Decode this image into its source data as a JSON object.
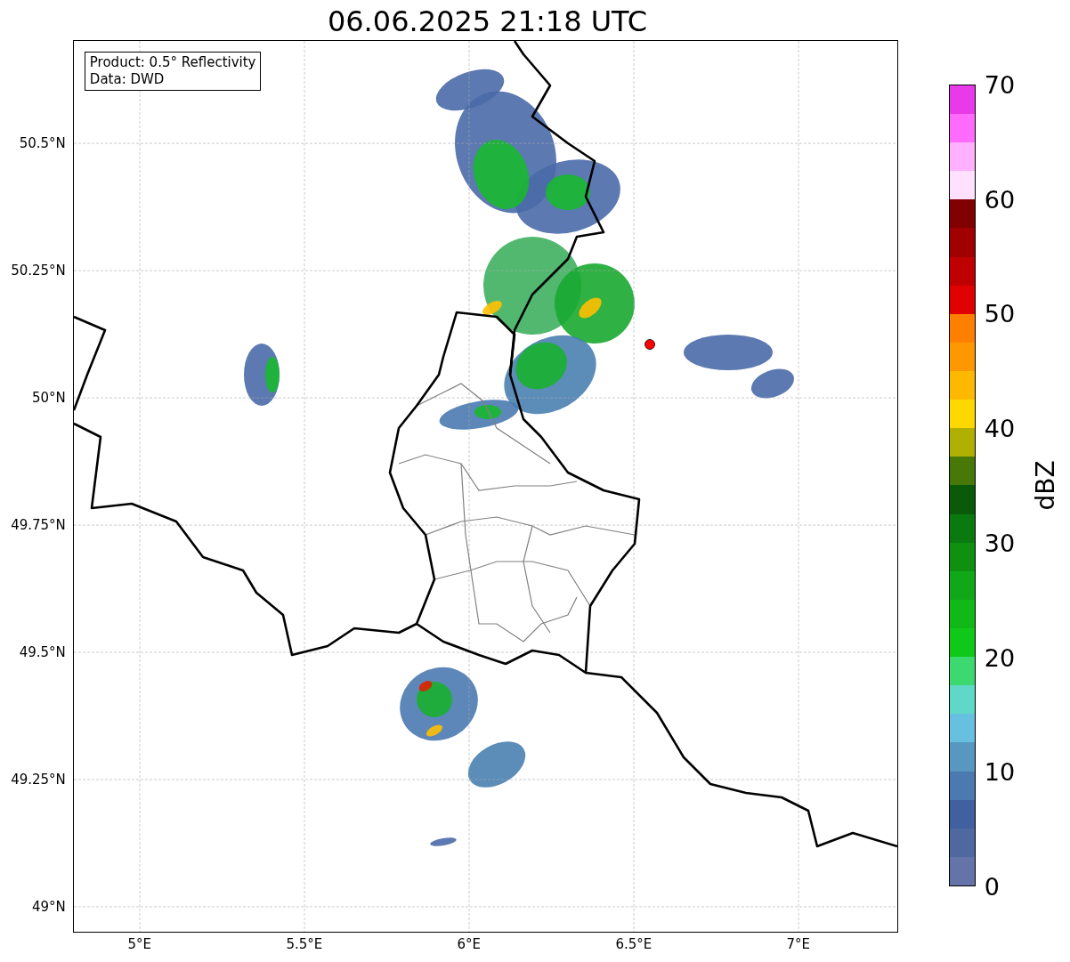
{
  "title": "06.06.2025 21:18 UTC",
  "map": {
    "info_lines": [
      "Product: 0.5° Reflectivity",
      "Data: DWD"
    ],
    "lat_labels": [
      "50.5°N",
      "50.25°N",
      "50°N",
      "49.75°N",
      "49.5°N",
      "49.25°N",
      "49°N"
    ],
    "lon_labels": [
      "5°E",
      "5.5°E",
      "6°E",
      "6.5°E",
      "7°E"
    ]
  },
  "colorbar": {
    "label": "dBZ",
    "ticks": [
      "70",
      "60",
      "50",
      "40",
      "30",
      "20",
      "10",
      "0"
    ],
    "bands": [
      {
        "color": "#6474a8"
      },
      {
        "color": "#5068a0"
      },
      {
        "color": "#4060a0"
      },
      {
        "color": "#4a7ab0"
      },
      {
        "color": "#5898c0"
      },
      {
        "color": "#68c0e0"
      },
      {
        "color": "#60d8c8"
      },
      {
        "color": "#3cd870"
      },
      {
        "color": "#10c818"
      },
      {
        "color": "#10b818"
      },
      {
        "color": "#10a818"
      },
      {
        "color": "#109010"
      },
      {
        "color": "#0a7a10"
      },
      {
        "color": "#0a5a0a"
      },
      {
        "color": "#487808"
      },
      {
        "color": "#b0b000"
      },
      {
        "color": "#ffd800"
      },
      {
        "color": "#ffb800"
      },
      {
        "color": "#ff9800"
      },
      {
        "color": "#ff8000"
      },
      {
        "color": "#e00000"
      },
      {
        "color": "#c00000"
      },
      {
        "color": "#a00000"
      },
      {
        "color": "#800000"
      },
      {
        "color": "#ffe0ff"
      },
      {
        "color": "#ffb0ff"
      },
      {
        "color": "#ff6aff"
      },
      {
        "color": "#e83ae8"
      }
    ]
  }
}
